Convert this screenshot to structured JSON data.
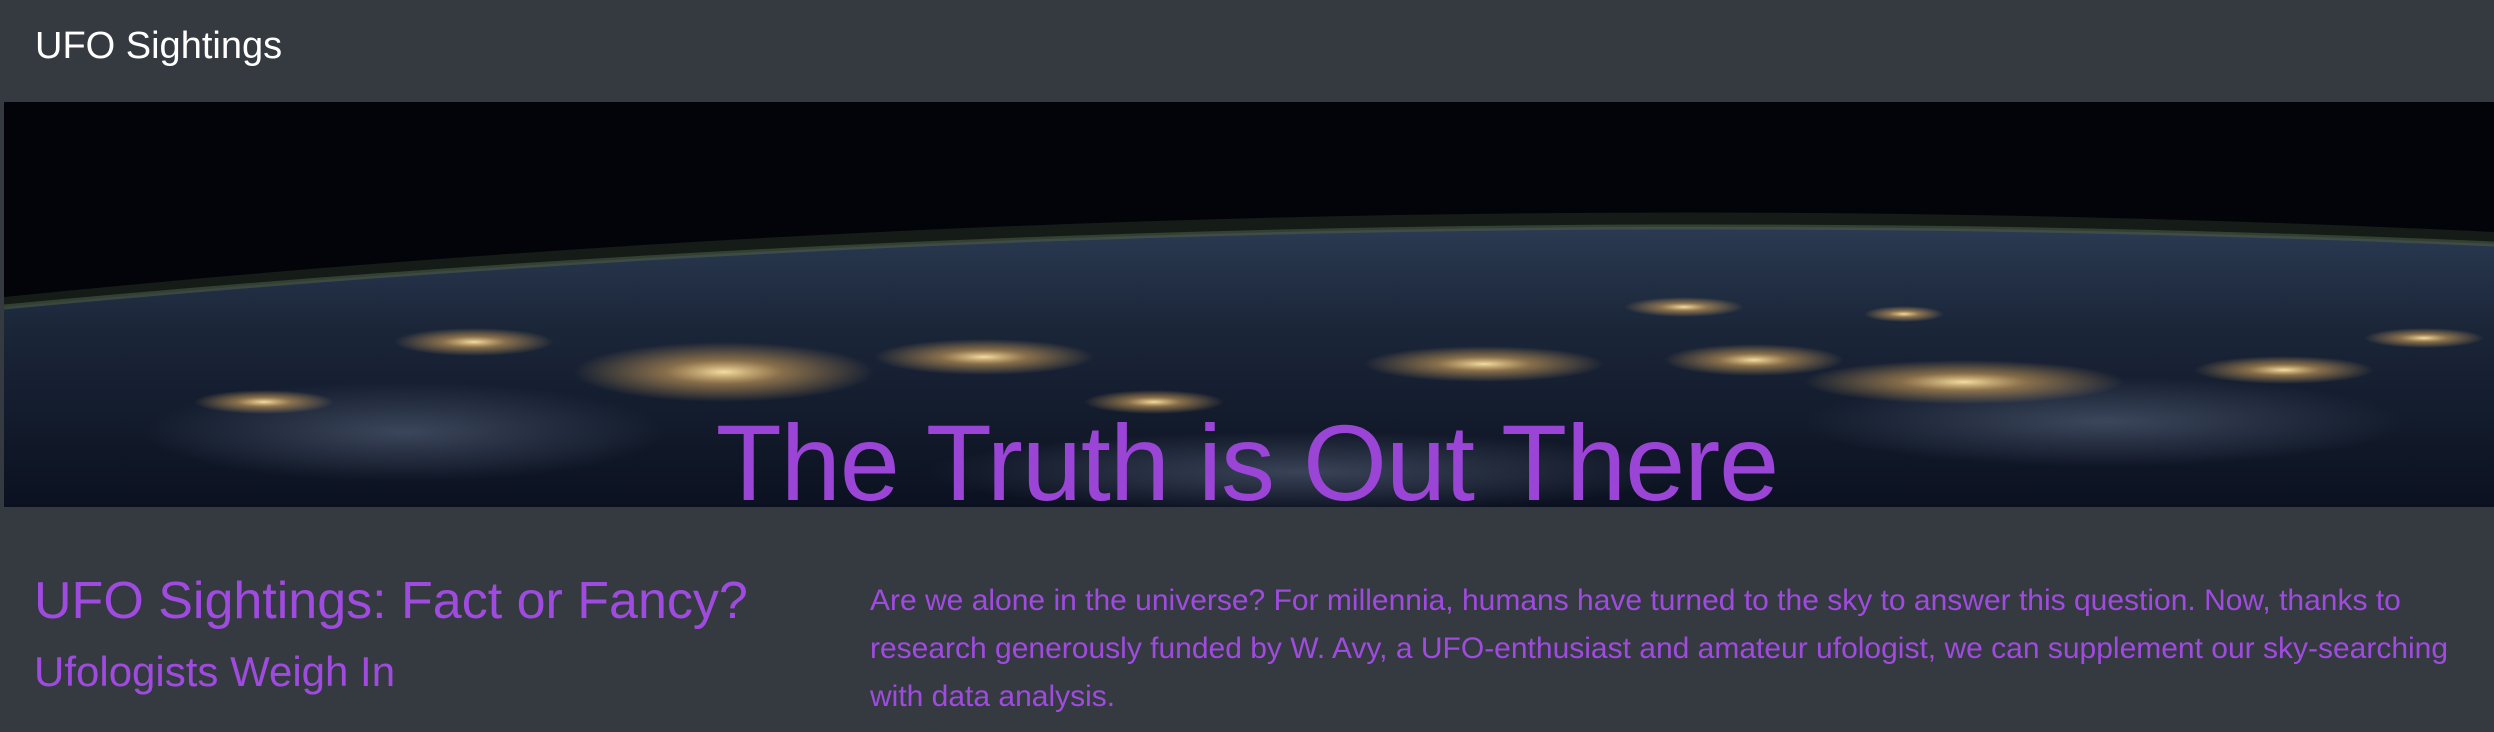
{
  "navbar": {
    "brand": "UFO Sightings"
  },
  "hero": {
    "title": "The Truth is Out There",
    "background": "earth-at-night-from-space"
  },
  "main": {
    "headline": "UFO Sightings: Fact or Fancy?",
    "subheadline": "Ufologists Weigh In",
    "intro": "Are we alone in the universe? For millennia, humans have turned to the sky to answer this question. Now, thanks to research generously funded by W. Avy, a UFO-enthusiast and amateur ufologist, we can supplement our sky-searching with data analysis."
  },
  "colors": {
    "background": "#343a40",
    "accent": "#a04be0",
    "brand_text": "#ffffff"
  }
}
